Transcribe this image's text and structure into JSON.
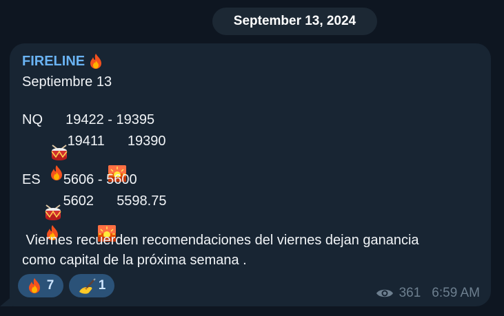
{
  "chat": {
    "date": "September 13, 2024"
  },
  "message": {
    "sender": "FIRELINE",
    "sender_icon": "fire-icon",
    "date_line": "Septiembre 13",
    "nq": {
      "label": "NQ",
      "range": "19422 - 19395",
      "fire_value": "19411",
      "sunset_value": "19390"
    },
    "es": {
      "label": "ES",
      "range": "5606 - 5600",
      "fire_value": "5602",
      "sunset_value": "5598.75"
    },
    "body_line1": " Viernes recuerden recomendaciones del viernes dejan ganancia",
    "body_line2": "como capital de la próxima semana .",
    "reactions": [
      {
        "icon": "fire-icon",
        "count": "7"
      },
      {
        "icon": "writing-hand-icon",
        "count": "1"
      }
    ],
    "views": "361",
    "time": "6:59 AM"
  },
  "colors": {
    "background": "#0e1621",
    "bubble": "#182533",
    "sender": "#6ab3f3",
    "reaction_bg": "#2b5278",
    "meta": "#6d7f8f"
  }
}
